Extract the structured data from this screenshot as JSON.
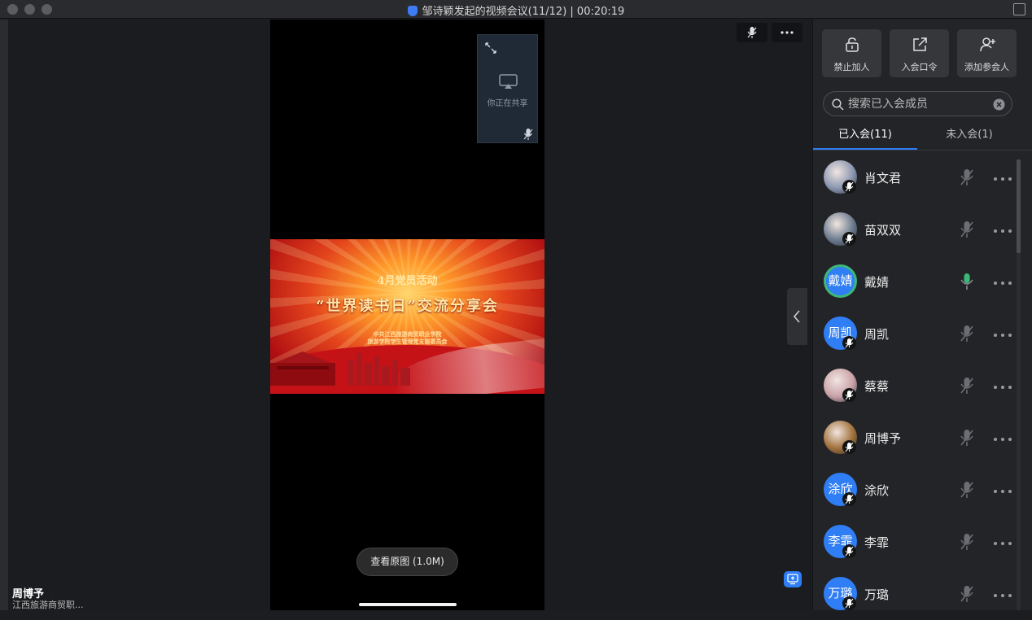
{
  "window": {
    "title": "邹诗颖发起的视频会议(11/12) | 00:20:19"
  },
  "banner": {
    "line1": "4月党员活动",
    "line2": "“世界读书日”交流分享会",
    "line3": "中共江西旅游商贸职业学院",
    "line4": "旅游学院学生管理党支部委员会"
  },
  "share_card": {
    "label": "你正在共享"
  },
  "view_original": {
    "label": "查看原图 (1.0M)"
  },
  "speaker": {
    "name": "周博予",
    "org": "江西旅游商贸职..."
  },
  "panel": {
    "actions": [
      {
        "label": "禁止加人",
        "icon": "lock-icon"
      },
      {
        "label": "入会口令",
        "icon": "external-link-icon"
      },
      {
        "label": "添加参会人",
        "icon": "add-user-icon"
      }
    ],
    "search": {
      "placeholder": "搜索已入会成员"
    },
    "tabs": [
      {
        "label": "已入会(11)",
        "active": true
      },
      {
        "label": "未入会(1)",
        "active": false
      }
    ],
    "members": [
      {
        "name": "肖文君",
        "avatar_text": "",
        "avatar_color": "#8a96b0",
        "mic": "muted"
      },
      {
        "name": "苗双双",
        "avatar_text": "",
        "avatar_color": "#6b7a8e",
        "mic": "muted"
      },
      {
        "name": "戴婧",
        "avatar_text": "戴婧",
        "avatar_color": "#2f7ef5",
        "mic": "active"
      },
      {
        "name": "周凯",
        "avatar_text": "周凯",
        "avatar_color": "#2f7ef5",
        "mic": "muted"
      },
      {
        "name": "蔡蔡",
        "avatar_text": "",
        "avatar_color": "#c9a2a8",
        "mic": "muted"
      },
      {
        "name": "周博予",
        "avatar_text": "",
        "avatar_color": "#a0703a",
        "mic": "muted"
      },
      {
        "name": "涂欣",
        "avatar_text": "涂欣",
        "avatar_color": "#2f7ef5",
        "mic": "muted"
      },
      {
        "name": "李霏",
        "avatar_text": "李霏",
        "avatar_color": "#2f7ef5",
        "mic": "muted"
      },
      {
        "name": "万璐",
        "avatar_text": "万璐",
        "avatar_color": "#2f7ef5",
        "mic": "muted"
      }
    ]
  }
}
